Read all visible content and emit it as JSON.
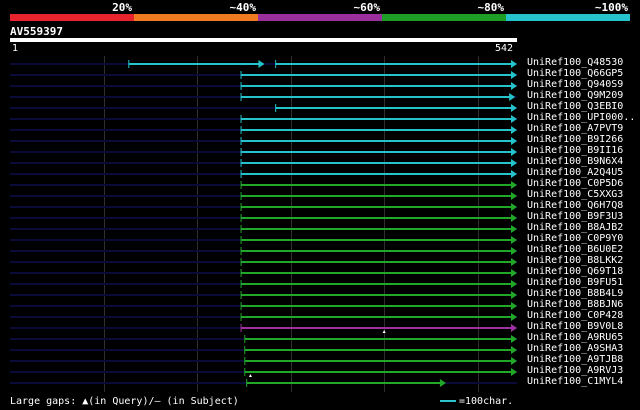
{
  "legend": {
    "segments": [
      {
        "label": "20%",
        "color": "#e8232e"
      },
      {
        "label": "~40%",
        "color": "#ef7a1f"
      },
      {
        "label": "~60%",
        "color": "#9b2f9e"
      },
      {
        "label": "~80%",
        "color": "#1e9e26"
      },
      {
        "label": "~100%",
        "color": "#25c3cc"
      }
    ]
  },
  "query": {
    "id": "AV559397",
    "start": "1",
    "end": "542",
    "length": 542
  },
  "colors": {
    "cyan": "#25c3cc",
    "green": "#21a829",
    "purple": "#a032a0",
    "navy": "#0b0b3a",
    "grid": "#2f2f2f"
  },
  "hits": [
    {
      "name": "UniRef100_Q48530",
      "color": "cyan",
      "segments": [
        [
          127,
          272
        ],
        [
          284,
          542
        ]
      ]
    },
    {
      "name": "UniRef100_Q66GP5",
      "color": "cyan",
      "segments": [
        [
          247,
          542
        ]
      ]
    },
    {
      "name": "UniRef100_Q940S9",
      "color": "cyan",
      "segments": [
        [
          247,
          542
        ]
      ]
    },
    {
      "name": "UniRef100_Q9M209",
      "color": "cyan",
      "segments": [
        [
          247,
          540
        ]
      ]
    },
    {
      "name": "UniRef100_Q3EBI0",
      "color": "cyan",
      "segments": [
        [
          284,
          542
        ]
      ]
    },
    {
      "name": "UniRef100_UPI000..",
      "color": "cyan",
      "segments": [
        [
          247,
          542
        ]
      ]
    },
    {
      "name": "UniRef100_A7PVT9",
      "color": "cyan",
      "segments": [
        [
          247,
          542
        ]
      ]
    },
    {
      "name": "UniRef100_B9I266",
      "color": "cyan",
      "segments": [
        [
          247,
          542
        ]
      ]
    },
    {
      "name": "UniRef100_B9II16",
      "color": "cyan",
      "segments": [
        [
          247,
          542
        ]
      ]
    },
    {
      "name": "UniRef100_B9N6X4",
      "color": "cyan",
      "segments": [
        [
          247,
          542
        ]
      ]
    },
    {
      "name": "UniRef100_A2Q4U5",
      "color": "cyan",
      "segments": [
        [
          247,
          542
        ]
      ]
    },
    {
      "name": "UniRef100_C0P5D6",
      "color": "green",
      "segments": [
        [
          247,
          542
        ]
      ]
    },
    {
      "name": "UniRef100_C5XXG3",
      "color": "green",
      "segments": [
        [
          247,
          542
        ]
      ]
    },
    {
      "name": "UniRef100_Q6H7Q8",
      "color": "green",
      "segments": [
        [
          247,
          542
        ]
      ]
    },
    {
      "name": "UniRef100_B9F3U3",
      "color": "green",
      "segments": [
        [
          247,
          542
        ]
      ]
    },
    {
      "name": "UniRef100_B8AJB2",
      "color": "green",
      "segments": [
        [
          247,
          542
        ]
      ]
    },
    {
      "name": "UniRef100_C0P9Y0",
      "color": "green",
      "segments": [
        [
          247,
          542
        ]
      ]
    },
    {
      "name": "UniRef100_B6U0E2",
      "color": "green",
      "segments": [
        [
          247,
          542
        ]
      ]
    },
    {
      "name": "UniRef100_B8LKK2",
      "color": "green",
      "segments": [
        [
          247,
          542
        ]
      ]
    },
    {
      "name": "UniRef100_Q69T18",
      "color": "green",
      "segments": [
        [
          247,
          542
        ]
      ]
    },
    {
      "name": "UniRef100_B9FU51",
      "color": "green",
      "segments": [
        [
          247,
          542
        ]
      ]
    },
    {
      "name": "UniRef100_B8B4L9",
      "color": "green",
      "segments": [
        [
          247,
          542
        ]
      ]
    },
    {
      "name": "UniRef100_B8BJN6",
      "color": "green",
      "segments": [
        [
          247,
          542
        ]
      ]
    },
    {
      "name": "UniRef100_C0P428",
      "color": "green",
      "segments": [
        [
          247,
          542
        ]
      ]
    },
    {
      "name": "UniRef100_B9V0L8",
      "color": "purple",
      "segments": [
        [
          247,
          542
        ]
      ],
      "marker": 400
    },
    {
      "name": "UniRef100_A9RU65",
      "color": "green",
      "segments": [
        [
          251,
          542
        ]
      ]
    },
    {
      "name": "UniRef100_A9SHA3",
      "color": "green",
      "segments": [
        [
          251,
          542
        ]
      ]
    },
    {
      "name": "UniRef100_A9TJB8",
      "color": "green",
      "segments": [
        [
          251,
          542
        ]
      ]
    },
    {
      "name": "UniRef100_A9RVJ3",
      "color": "green",
      "segments": [
        [
          251,
          542
        ]
      ],
      "marker": 257
    },
    {
      "name": "UniRef100_C1MYL4",
      "color": "green",
      "segments": [
        [
          253,
          466
        ]
      ]
    }
  ],
  "footer": {
    "gaps_text": "Large gaps: ▲(in Query)/– (in Subject)",
    "scale_text": "=100char."
  }
}
